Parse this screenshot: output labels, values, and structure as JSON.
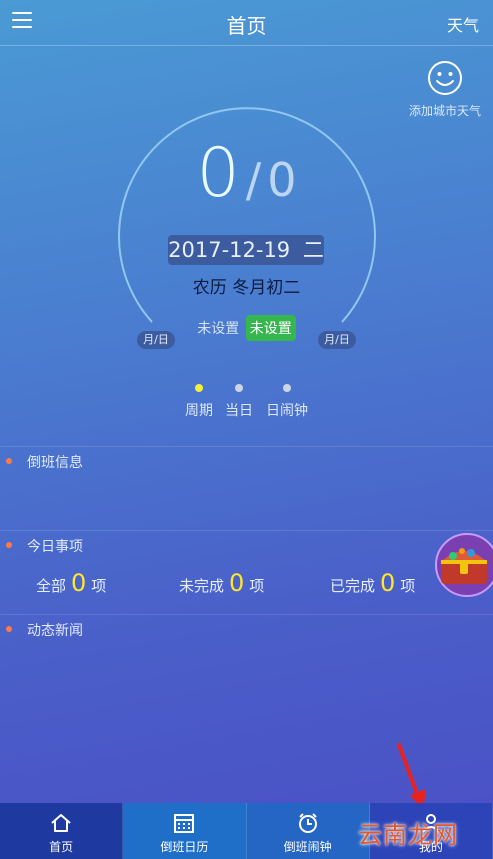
{
  "header": {
    "title": "首页",
    "weather_link": "天气"
  },
  "add_city_weather": {
    "label": "添加城市天气"
  },
  "dial": {
    "count_current": "0",
    "count_separator": "/",
    "count_total": "0",
    "date": "2017-12-19",
    "weekday": "二",
    "lunar": "农历 冬月初二",
    "unset_label": "未设置",
    "unset_button": "未设置",
    "left_badge": "月/日",
    "right_badge": "月/日"
  },
  "pager": {
    "items": [
      {
        "label": "周期",
        "color": "#f5f03a"
      },
      {
        "label": "当日",
        "color": "#cdd6e4"
      },
      {
        "label": "日闹钟",
        "color": "#cdd6e4"
      }
    ]
  },
  "sections": {
    "shift_info": "倒班信息",
    "today_items": "今日事项",
    "news": "动态新闻"
  },
  "today_stats": [
    {
      "label": "全部",
      "value": "0",
      "unit": "项"
    },
    {
      "label": "未完成",
      "value": "0",
      "unit": "项"
    },
    {
      "label": "已完成",
      "value": "0",
      "unit": "项"
    }
  ],
  "tabs": [
    {
      "label": "首页",
      "icon": "home-icon"
    },
    {
      "label": "倒班日历",
      "icon": "calendar-icon"
    },
    {
      "label": "倒班闹钟",
      "icon": "alarm-clock-icon"
    },
    {
      "label": "我的",
      "icon": "profile-icon"
    }
  ],
  "watermark": "云南龙网",
  "colors": {
    "accent_green": "#36b64e",
    "stat_yellow": "#ffe52c",
    "bullet_orange": "#ff7b45",
    "arrow_red": "#e8231f"
  }
}
